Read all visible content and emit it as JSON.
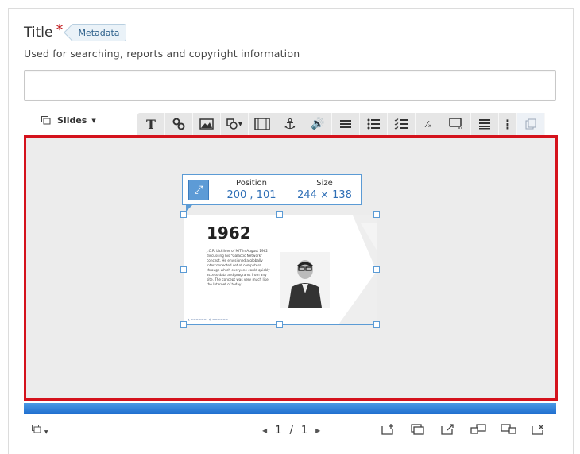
{
  "field": {
    "title_label": "Title",
    "required_mark": "*",
    "metadata_tag": "Metadata",
    "helper_text": "Used for searching, reports and copyright information",
    "title_value": ""
  },
  "editor": {
    "slides_label": "Slides",
    "toolbar_icons": [
      "text-icon",
      "link-icon",
      "image-icon",
      "shape-icon",
      "video-icon",
      "anchor-icon",
      "audio-icon",
      "table-icon",
      "bullet-list-icon",
      "checklist-icon",
      "math-icon",
      "tooltip-icon",
      "list-icon",
      "more-icon",
      "paste-icon"
    ]
  },
  "selection": {
    "position_label": "Position",
    "position_value": "200 , 101",
    "size_label": "Size",
    "size_value": "244 × 138"
  },
  "slide": {
    "year": "1962",
    "body": "J.C.R. Licklider of MIT in August 1962 discussing his \"Galactic Network\" concept. He envisioned a globally interconnected set of computers through which everyone could quickly access data and programs from any site. The concept was very much like the Internet of today."
  },
  "pager": {
    "current": "1",
    "separator": "/",
    "total": "1"
  },
  "colors": {
    "highlight_border": "#d4121c",
    "progress_bar": "#2a7ad6",
    "selection_blue": "#5b9bd5"
  }
}
